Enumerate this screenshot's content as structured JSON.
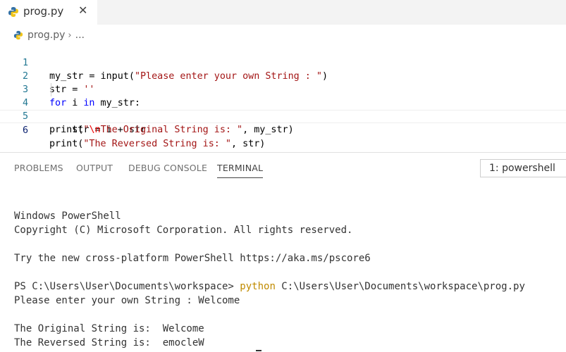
{
  "tab": {
    "filename": "prog.py",
    "close": "✕"
  },
  "breadcrumb": {
    "file": "prog.py",
    "separator": "›",
    "ellipsis": "..."
  },
  "editor": {
    "line_numbers": [
      "1",
      "2",
      "3",
      "4",
      "5",
      "6"
    ],
    "lines": {
      "l1_a": "my_str = input(",
      "l1_str": "\"Please enter your own String : \"",
      "l1_b": ")",
      "l2_a": "str = ",
      "l2_str": "''",
      "l3_kw1": "for",
      "l3_a": " i ",
      "l3_kw2": "in",
      "l3_b": " my_str:",
      "l4_a": "    str = i + str",
      "l5_a": "print(",
      "l5_str1": "\"",
      "l5_esc": "\\n",
      "l5_str2": "The Original String is: \"",
      "l5_b": ", my_str)",
      "l6_a": "print(",
      "l6_str": "\"The Reversed String is: \"",
      "l6_b": ", str)"
    }
  },
  "panel": {
    "tabs": [
      "PROBLEMS",
      "OUTPUT",
      "DEBUG CONSOLE",
      "TERMINAL"
    ],
    "terminal_select": "1: powershell"
  },
  "terminal": {
    "line1": "Windows PowerShell",
    "line2": "Copyright (C) Microsoft Corporation. All rights reserved.",
    "line3": "Try the new cross-platform PowerShell https://aka.ms/pscore6",
    "prompt": "PS C:\\Users\\User\\Documents\\workspace> ",
    "command": "python",
    "command_arg": " C:\\Users\\User\\Documents\\workspace\\prog.py",
    "line5": "Please enter your own String : Welcome",
    "line6": "The Original String is:  Welcome",
    "line7": "The Reversed String is:  emocleW"
  },
  "colors": {
    "keyword": "#0000ff",
    "string": "#a31515",
    "escape": "#ee0000",
    "line_number": "#237893",
    "command": "#c08b00"
  }
}
